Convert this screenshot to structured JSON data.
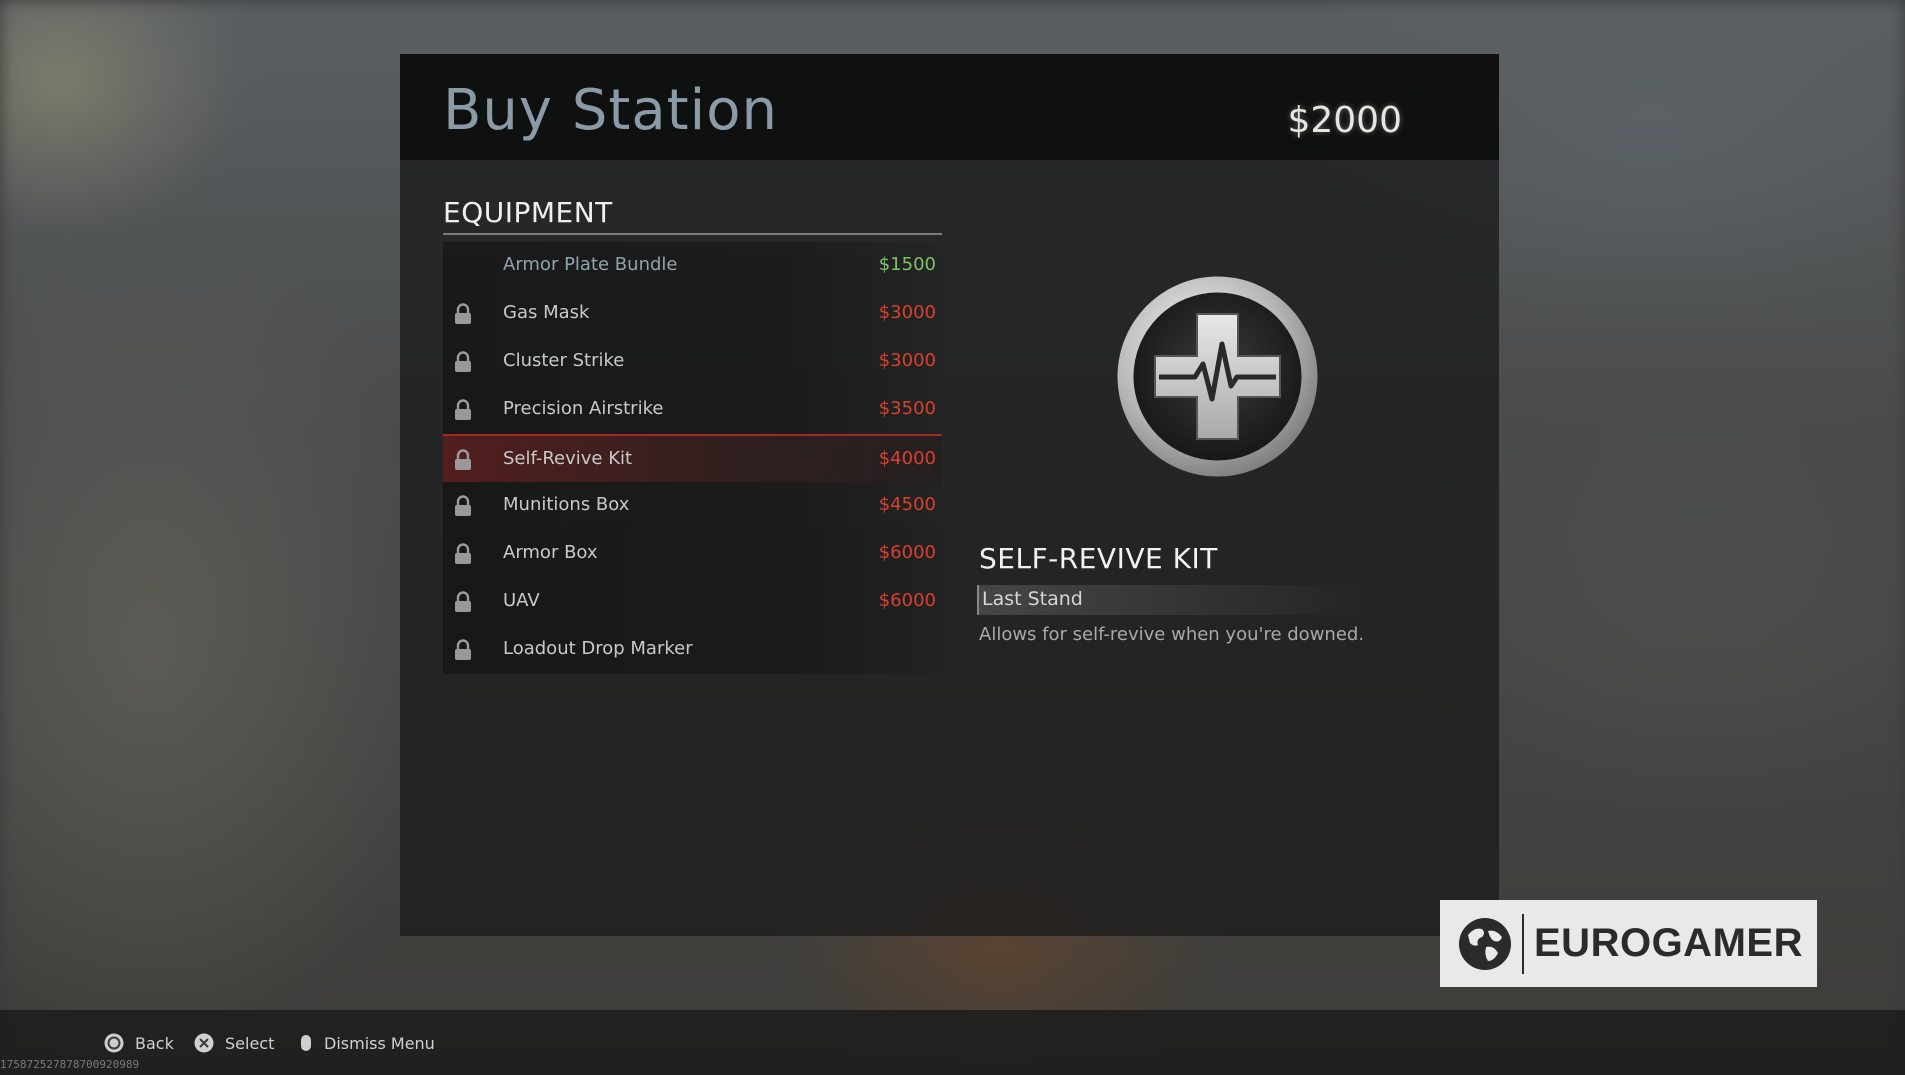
{
  "header": {
    "title": "Buy Station",
    "money": "$2000"
  },
  "equipment": {
    "section_title": "EQUIPMENT",
    "items": [
      {
        "name": "Armor Plate Bundle",
        "price": "$1500",
        "locked": false,
        "affordable": true,
        "selected": false
      },
      {
        "name": "Gas Mask",
        "price": "$3000",
        "locked": true,
        "affordable": false,
        "selected": false
      },
      {
        "name": "Cluster Strike",
        "price": "$3000",
        "locked": true,
        "affordable": false,
        "selected": false
      },
      {
        "name": "Precision Airstrike",
        "price": "$3500",
        "locked": true,
        "affordable": false,
        "selected": false
      },
      {
        "name": "Self-Revive Kit",
        "price": "$4000",
        "locked": true,
        "affordable": false,
        "selected": true
      },
      {
        "name": "Munitions Box",
        "price": "$4500",
        "locked": true,
        "affordable": false,
        "selected": false
      },
      {
        "name": "Armor Box",
        "price": "$6000",
        "locked": true,
        "affordable": false,
        "selected": false
      },
      {
        "name": "UAV",
        "price": "$6000",
        "locked": true,
        "affordable": false,
        "selected": false
      },
      {
        "name": "Loadout Drop Marker",
        "price": "",
        "locked": true,
        "affordable": false,
        "selected": false
      }
    ]
  },
  "detail": {
    "icon": "medical-cross-icon",
    "title": "SELF-REVIVE KIT",
    "subtitle": "Last Stand",
    "description": "Allows for self-revive when you're downed."
  },
  "footer": {
    "hints": [
      {
        "icon": "circle-button-icon",
        "label": "Back"
      },
      {
        "icon": "cross-button-icon",
        "label": "Select"
      },
      {
        "icon": "touchpad-icon",
        "label": "Dismiss Menu"
      }
    ],
    "build_id": "17587252787870092098​9"
  },
  "watermark": {
    "brand": "EUROGAMER",
    "icon": "globe-icon"
  },
  "colors": {
    "price_unaffordable": "#d8402f",
    "price_affordable": "#7ec26a",
    "selected_accent": "#a12a26",
    "title": "#8a9aa6"
  }
}
